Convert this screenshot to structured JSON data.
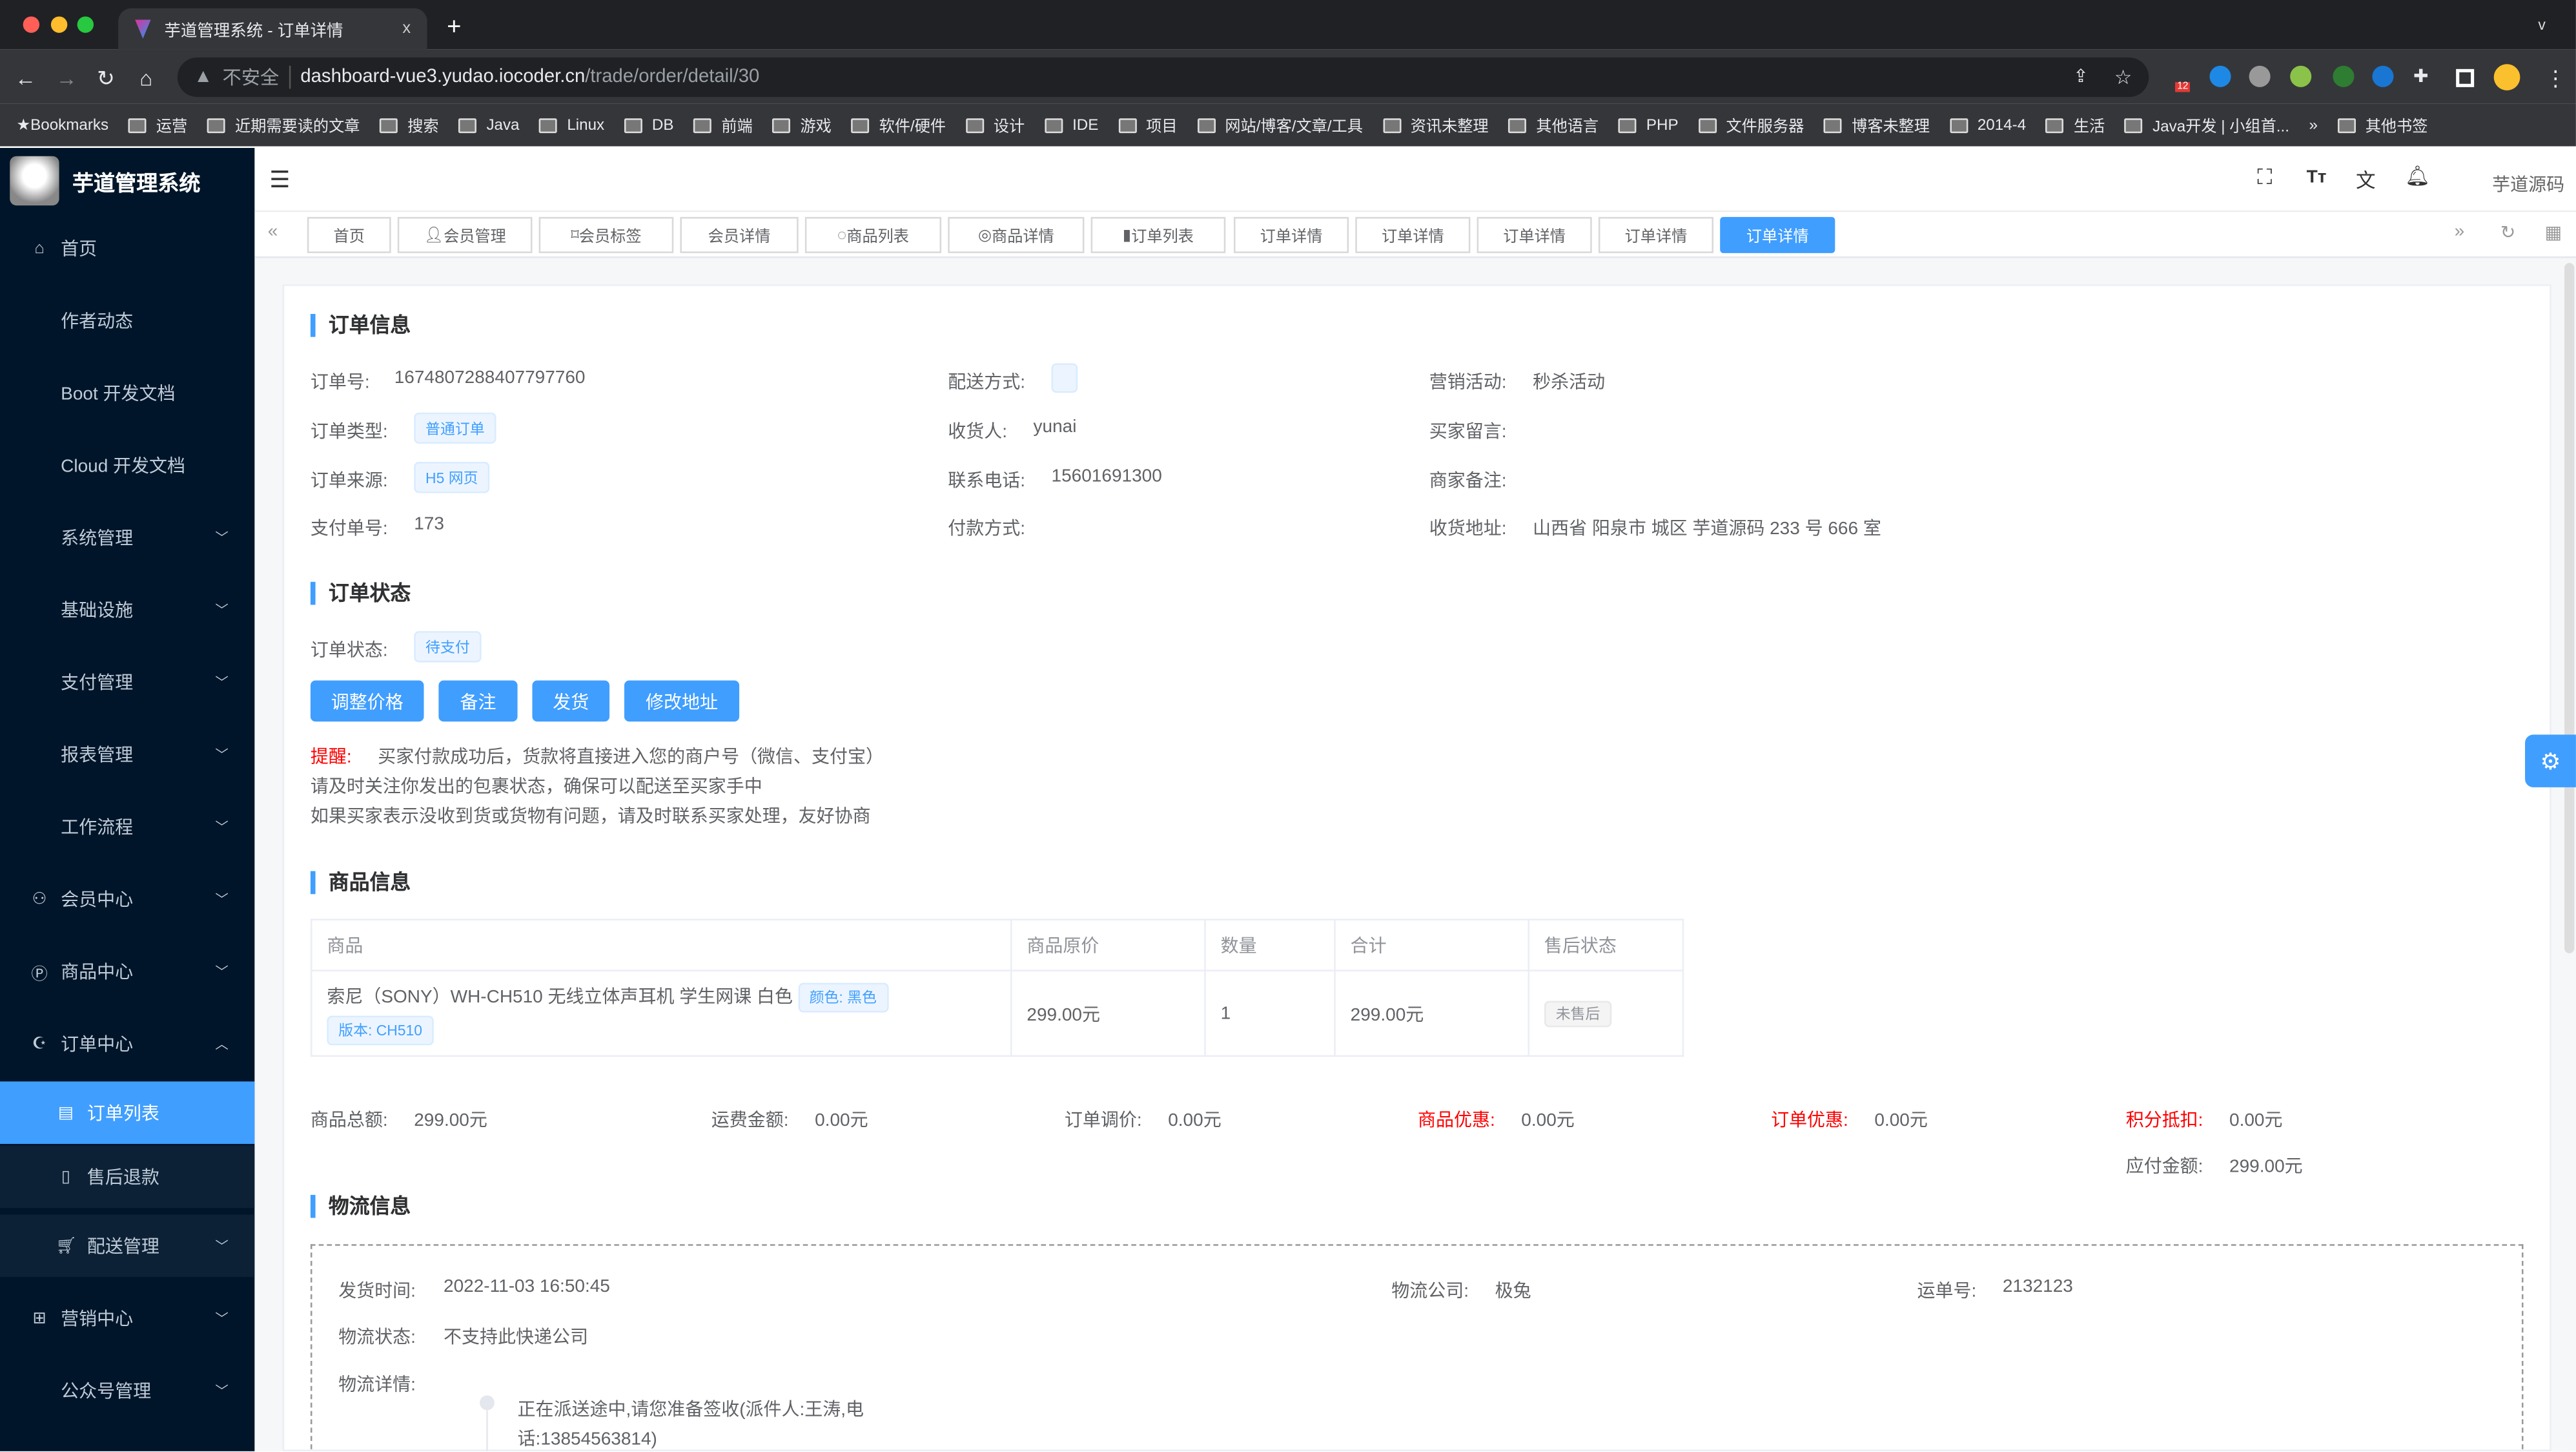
{
  "browser": {
    "tab_title": "芋道管理系统 - 订单详情",
    "close": "x",
    "new_tab": "+",
    "security": "不安全",
    "url_host": "dashboard-vue3.yudao.iocoder.cn",
    "url_path": "/trade/order/detail/30",
    "ext_badge": "12",
    "bookmarks": [
      "Bookmarks",
      "运营",
      "近期需要读的文章",
      "搜索",
      "Java",
      "Linux",
      "DB",
      "前端",
      "游戏",
      "软件/硬件",
      "设计",
      "IDE",
      "项目",
      "网站/博客/文章/工具",
      "资讯未整理",
      "其他语言",
      "PHP",
      "文件服务器",
      "博客未整理",
      "2014-4",
      "生活",
      "Java开发 | 小组首...",
      "»",
      "其他书签"
    ]
  },
  "sidebar": {
    "title": "芋道管理系统",
    "items": [
      {
        "label": "首页",
        "icon": "home-icon"
      },
      {
        "label": "作者动态"
      },
      {
        "label": "Boot 开发文档"
      },
      {
        "label": "Cloud 开发文档"
      },
      {
        "label": "系统管理",
        "chevron": "down"
      },
      {
        "label": "基础设施",
        "chevron": "down"
      },
      {
        "label": "支付管理",
        "chevron": "down"
      },
      {
        "label": "报表管理",
        "chevron": "down"
      },
      {
        "label": "工作流程",
        "chevron": "down"
      },
      {
        "label": "会员中心",
        "icon": "member-icon",
        "chevron": "down"
      },
      {
        "label": "商品中心",
        "icon": "product-icon",
        "chevron": "down"
      },
      {
        "label": "订单中心",
        "icon": "order-icon",
        "chevron": "up"
      },
      {
        "label": "订单列表",
        "icon": "list-icon",
        "active": true
      },
      {
        "label": "售后退款",
        "icon": "refund-icon"
      },
      {
        "label": "配送管理",
        "icon": "cart-icon",
        "chevron": "down"
      },
      {
        "label": "营销中心",
        "icon": "gift-icon",
        "chevron": "down"
      },
      {
        "label": "公众号管理",
        "chevron": "down"
      }
    ]
  },
  "header": {
    "user": "芋道源码"
  },
  "tabs": [
    {
      "label": "首页"
    },
    {
      "label": "会员管理",
      "icon": "user-icon"
    },
    {
      "label": "会员标签",
      "icon": "tag-icon"
    },
    {
      "label": "会员详情"
    },
    {
      "label": "商品列表",
      "icon": "apple-icon"
    },
    {
      "label": "商品详情",
      "icon": "eye-icon"
    },
    {
      "label": "订单列表",
      "icon": "list-icon"
    },
    {
      "label": "订单详情"
    },
    {
      "label": "订单详情"
    },
    {
      "label": "订单详情"
    },
    {
      "label": "订单详情"
    },
    {
      "label": "订单详情",
      "active": true
    }
  ],
  "order_info": {
    "title": "订单信息",
    "order_no_label": "订单号:",
    "order_no": "1674807288407797760",
    "type_label": "订单类型:",
    "type": "普通订单",
    "source_label": "订单来源:",
    "source": "H5 网页",
    "pay_no_label": "支付单号:",
    "pay_no": "173",
    "delivery_label": "配送方式:",
    "receiver_label": "收货人:",
    "receiver": "yunai",
    "phone_label": "联系电话:",
    "phone": "15601691300",
    "pay_method_label": "付款方式:",
    "promo_label": "营销活动:",
    "promo": "秒杀活动",
    "buyer_msg_label": "买家留言:",
    "merchant_note_label": "商家备注:",
    "address_label": "收货地址:",
    "address": "山西省 阳泉市 城区 芋道源码 233 号 666 室"
  },
  "order_status": {
    "title": "订单状态",
    "status_label": "订单状态:",
    "status": "待支付",
    "buttons": [
      "调整价格",
      "备注",
      "发货",
      "修改地址"
    ],
    "reminder_label": "提醒:",
    "reminder_lines": [
      "买家付款成功后，货款将直接进入您的商户号（微信、支付宝）",
      "请及时关注你发出的包裹状态，确保可以配送至买家手中",
      "如果买家表示没收到货或货物有问题，请及时联系买家处理，友好协商"
    ]
  },
  "goods": {
    "title": "商品信息",
    "columns": [
      "商品",
      "商品原价",
      "数量",
      "合计",
      "售后状态"
    ],
    "rows": [
      {
        "name": "索尼（SONY）WH-CH510 无线立体声耳机 学生网课 白色",
        "props": [
          "颜色: 黑色",
          "版本: CH510"
        ],
        "price": "299.00元",
        "count": "1",
        "total": "299.00元",
        "after_sale": "未售后"
      }
    ]
  },
  "summary": [
    {
      "label": "商品总额:",
      "value": "299.00元"
    },
    {
      "label": "运费金额:",
      "value": "0.00元"
    },
    {
      "label": "订单调价:",
      "value": "0.00元"
    },
    {
      "label": "商品优惠:",
      "value": "0.00元",
      "red": true
    },
    {
      "label": "订单优惠:",
      "value": "0.00元",
      "red": true
    },
    {
      "label": "积分抵扣:",
      "value": "0.00元",
      "red": true
    },
    {
      "label": "应付金额:",
      "value": "299.00元"
    }
  ],
  "logistics": {
    "title": "物流信息",
    "ship_time_label": "发货时间:",
    "ship_time": "2022-11-03 16:50:45",
    "company_label": "物流公司:",
    "company": "极兔",
    "waybill_label": "运单号:",
    "waybill": "2132123",
    "status_label": "物流状态:",
    "status": "不支持此快递公司",
    "detail_label": "物流详情:",
    "detail_line1": "正在派送途中,请您准备签收(派件人:王涛,电",
    "detail_line2": "话:13854563814)"
  },
  "colors": {
    "primary": "#409eff",
    "sidebar": "#001529",
    "danger": "#f56c6c"
  }
}
